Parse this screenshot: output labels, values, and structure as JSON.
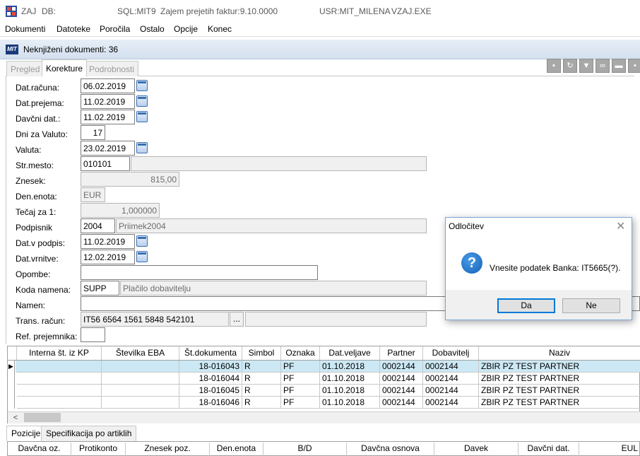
{
  "titlebar": {
    "app": "ZAJ",
    "db": "DB:",
    "sql": "SQL:MIT9",
    "caption": "Zajem prejetih faktur:9.10.0000",
    "user": "USR:MIT_MILENA",
    "exe": "VZAJ.EXE"
  },
  "menu": [
    "Dokumenti",
    "Datoteke",
    "Poročila",
    "Ostalo",
    "Opcije",
    "Konec"
  ],
  "doc": {
    "logo": "MIT",
    "title": "Neknjiženi dokumenti: 36"
  },
  "tabs": [
    "Pregled",
    "Korekture",
    "Podrobnosti"
  ],
  "form": {
    "dat_racuna": {
      "label": "Dat.računa:",
      "value": "06.02.2019"
    },
    "dat_prejema": {
      "label": "Dat.prejema:",
      "value": "11.02.2019"
    },
    "davcni_dat": {
      "label": "Davčni dat.:",
      "value": "11.02.2019"
    },
    "dni_za_valuto": {
      "label": "Dni za Valuto:",
      "value": "17"
    },
    "valuta": {
      "label": "Valuta:",
      "value": "23.02.2019"
    },
    "str_mesto": {
      "label": "Str.mesto:",
      "value": "010101",
      "desc": ""
    },
    "znesek": {
      "label": "Znesek:",
      "value": "815,00"
    },
    "den_enota": {
      "label": "Den.enota:",
      "value": "EUR"
    },
    "tecaj": {
      "label": "Tečaj za 1:",
      "value": "1,000000"
    },
    "podpisnik": {
      "label": "Podpisnik",
      "value": "2004",
      "desc": "Priimek2004"
    },
    "dat_v_podpis": {
      "label": "Dat.v podpis:",
      "value": "11.02.2019"
    },
    "dat_vrnitve": {
      "label": "Dat.vrnitve:",
      "value": "12.02.2019"
    },
    "opombe": {
      "label": "Opombe:",
      "value": ""
    },
    "koda_namena": {
      "label": "Koda namena:",
      "value": "SUPP",
      "desc": "Plačilo dobavitelju"
    },
    "namen": {
      "label": "Namen:",
      "value": ""
    },
    "trans_racun": {
      "label": "Trans. račun:",
      "value": "IT56 6564 1561 5848 542101",
      "button": "...",
      "desc": ""
    },
    "ref_prejemnika": {
      "label": "Ref. prejemnika:",
      "value": ""
    }
  },
  "grid": {
    "columns": [
      "Interna št. iz KP",
      "Številka EBA",
      "Št.dokumenta",
      "Simbol",
      "Oznaka",
      "Dat.veljave",
      "Partner",
      "Dobavitelj",
      "Naziv"
    ],
    "rows": [
      [
        "",
        "",
        "18-016043",
        "R",
        "PF",
        "01.10.2018",
        "0002144",
        "0002144",
        "ZBIR PZ TEST PARTNER"
      ],
      [
        "",
        "",
        "18-016044",
        "R",
        "PF",
        "01.10.2018",
        "0002144",
        "0002144",
        "ZBIR PZ TEST PARTNER"
      ],
      [
        "",
        "",
        "18-016045",
        "R",
        "PF",
        "01.10.2018",
        "0002144",
        "0002144",
        "ZBIR PZ TEST PARTNER"
      ],
      [
        "",
        "",
        "18-016046",
        "R",
        "PF",
        "01.10.2018",
        "0002144",
        "0002144",
        "ZBIR PZ TEST PARTNER"
      ]
    ],
    "selected_row": 0,
    "scroll_left_glyph": "<"
  },
  "bottom_tabs": [
    "Pozicije",
    "Specifikacija po artiklih"
  ],
  "bottom_grid": {
    "columns": [
      "Davčna oz.",
      "Protikonto",
      "Znesek poz.",
      "Den.enota",
      "B/D",
      "Davčna osnova",
      "Davek",
      "Davčni dat.",
      "EUL"
    ]
  },
  "dialog": {
    "title": "Odločitev",
    "close": "✕",
    "icon": "question-icon",
    "icon_glyph": "?",
    "message": "Vnesite podatek Banka: IT5665(?).",
    "yes": "Da",
    "no": "Ne"
  },
  "toolbar_icons": [
    "save-icon",
    "refresh-icon",
    "filter-icon",
    "link-icon",
    "book-icon",
    "print-icon"
  ],
  "colors": {
    "selection": "#cce8f4",
    "accent": "#0078d7",
    "doc_title_bg": "#d3e0ef"
  }
}
